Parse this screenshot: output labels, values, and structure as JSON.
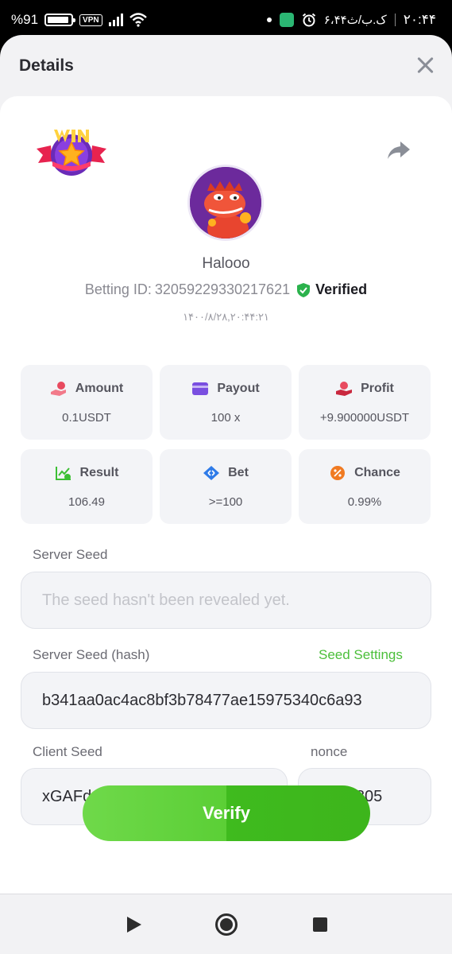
{
  "status_bar": {
    "battery": "%91",
    "vpn": "VPN",
    "date": "۶،۴۴ک.ب/ث",
    "time": "۲۰:۴۴"
  },
  "sheet": {
    "title": "Details"
  },
  "profile": {
    "username": "Halooo",
    "betting_id_label": "Betting ID:",
    "betting_id": "32059229330217621",
    "verified_label": "Verified",
    "datetime": "۱۴۰۰/۸/۲۸,۲۰:۴۴:۲۱"
  },
  "stats": [
    {
      "label": "Amount",
      "value": "0.1USDT",
      "icon": "coins-hand-icon",
      "color": "#e84a5f"
    },
    {
      "label": "Payout",
      "value": "100 x",
      "icon": "card-icon",
      "color": "#7a4fe0"
    },
    {
      "label": "Profit",
      "value": "+9.900000USDT",
      "icon": "money-hand-icon",
      "color": "#e84a5f"
    },
    {
      "label": "Result",
      "value": "106.49",
      "icon": "chart-check-icon",
      "color": "#3cbf34"
    },
    {
      "label": "Bet",
      "value": ">=100",
      "icon": "tag-arrows-icon",
      "color": "#2f7be8"
    },
    {
      "label": "Chance",
      "value": "0.99%",
      "icon": "percent-icon",
      "color": "#f07a22"
    }
  ],
  "seeds": {
    "server_seed_label": "Server Seed",
    "server_seed_placeholder": "The seed hasn't been revealed yet.",
    "server_seed_hash_label": "Server Seed (hash)",
    "seed_settings_label": "Seed Settings",
    "server_seed_hash": "b341aa0ac4ac8bf3b78477ae15975340c6a93",
    "client_seed_label": "Client Seed",
    "client_seed": "xGAFd4MQCs1000plinco",
    "nonce_label": "nonce",
    "nonce": "6805"
  },
  "actions": {
    "verify_label": "Verify"
  },
  "colors": {
    "accent_green": "#4bbf3a",
    "verified_green": "#2bb24c"
  }
}
